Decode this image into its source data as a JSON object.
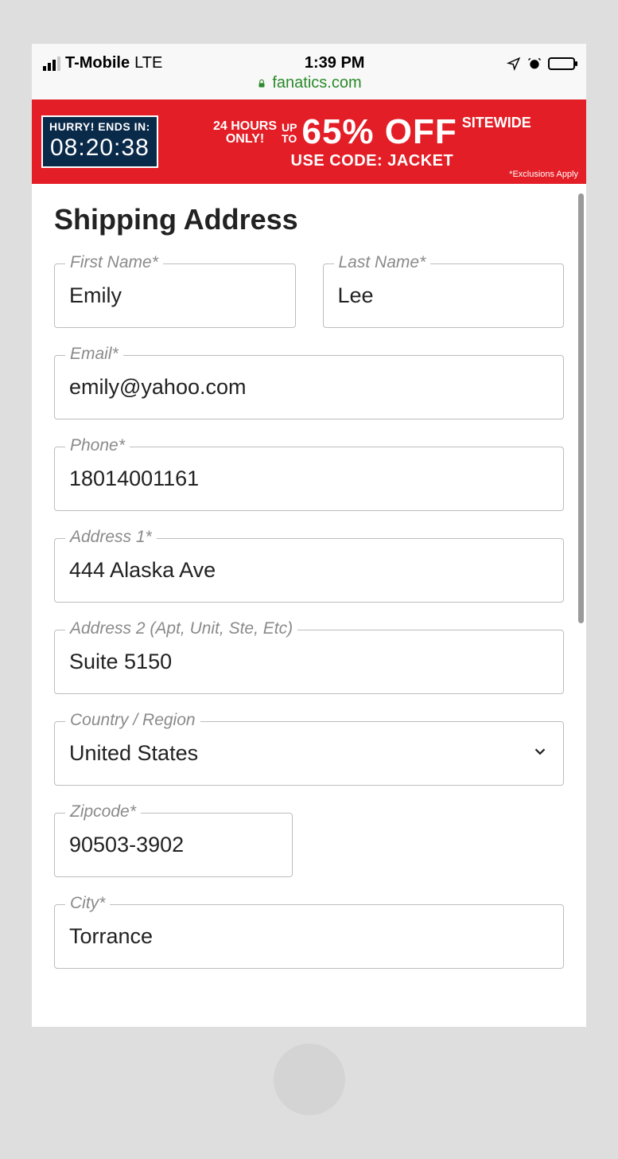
{
  "statusbar": {
    "carrier": "T-Mobile",
    "network": "LTE",
    "time": "1:39 PM",
    "url": "fanatics.com"
  },
  "promo": {
    "countdown_label": "HURRY! ENDS IN:",
    "countdown_time": "08:20:38",
    "hours_line1": "24 HOURS",
    "hours_line2": "ONLY!",
    "upto_line1": "UP",
    "upto_line2": "TO",
    "percent": "65% OFF",
    "sitewide": "SITEWIDE",
    "code": "USE CODE: JACKET",
    "exclusions": "*Exclusions Apply"
  },
  "page": {
    "title": "Shipping Address"
  },
  "labels": {
    "first_name": "First Name*",
    "last_name": "Last Name*",
    "email": "Email*",
    "phone": "Phone*",
    "address1": "Address 1*",
    "address2": "Address 2 (Apt, Unit, Ste, Etc)",
    "country": "Country / Region",
    "zip": "Zipcode*",
    "city": "City*"
  },
  "form": {
    "first_name": "Emily",
    "last_name": "Lee",
    "email": "emily@yahoo.com",
    "phone": "18014001161",
    "address1": "444 Alaska Ave",
    "address2": "Suite 5150",
    "country": "United States",
    "zip": "90503-3902",
    "city": "Torrance"
  }
}
